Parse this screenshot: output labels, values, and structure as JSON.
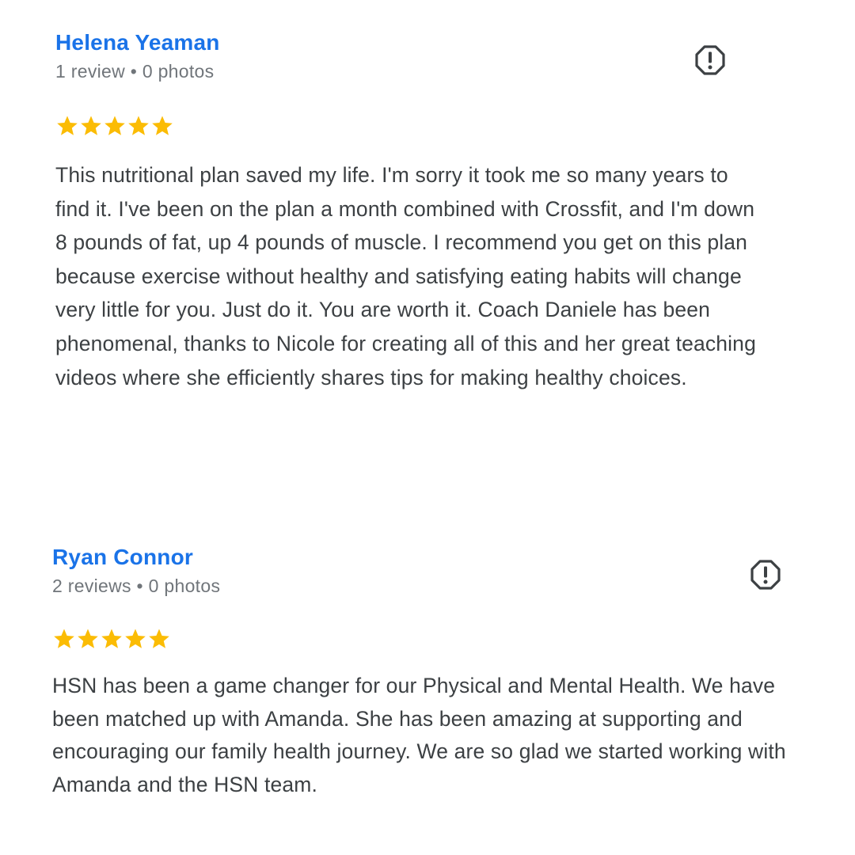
{
  "reviews": [
    {
      "author": "Helena Yeaman",
      "review_count": "1 review",
      "photo_count": "0 photos",
      "separator": "•",
      "rating": 5,
      "text": "This nutritional plan saved my life. I'm sorry it took me so many years to find it. I've been on the plan a month combined with Crossfit, and I'm down 8 pounds of fat, up 4 pounds of muscle. I recommend you get on this plan because exercise without healthy and satisfying eating habits will change very little for you. Just do it. You are worth it. Coach Daniele has been phenomenal, thanks to Nicole for creating all of this and her great teaching videos where she efficiently shares tips for making healthy choices.",
      "flag_icon": "report-flag-icon"
    },
    {
      "author": "Ryan Connor",
      "review_count": "2 reviews",
      "photo_count": "0 photos",
      "separator": "•",
      "rating": 5,
      "text": "HSN has been a game changer for our Physical and Mental Health. We have been matched up with Amanda. She has been amazing at supporting and encouraging our family health journey. We are so glad we started working with Amanda and the HSN team.",
      "flag_icon": "report-flag-icon"
    }
  ],
  "colors": {
    "author_link": "#1a73e8",
    "meta_text": "#70757a",
    "body_text": "#3c4043",
    "star": "#fbbc04",
    "flag_icon": "#3c4043"
  }
}
